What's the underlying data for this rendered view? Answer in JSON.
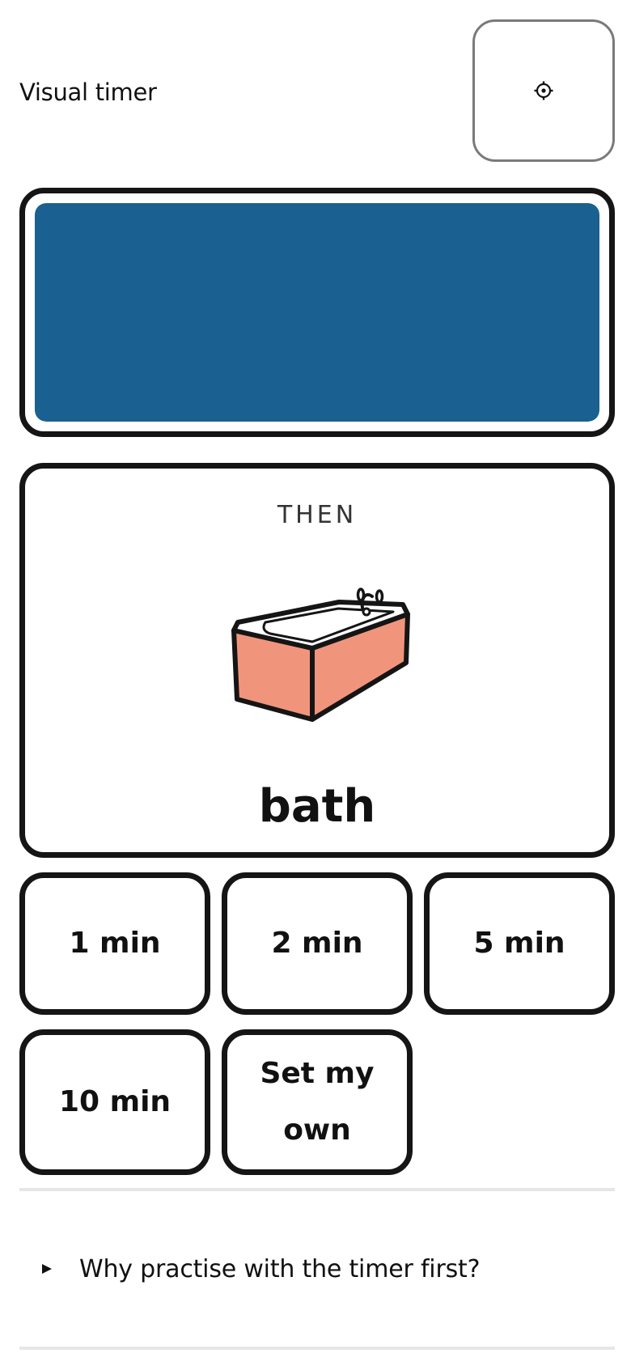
{
  "header": {
    "title": "Visual timer",
    "settings_glyph": "⚙",
    "settings_icon": "gear-icon"
  },
  "timer": {
    "remaining_fraction": 1.0,
    "fill_color": "#1a6090"
  },
  "then_card": {
    "label": "THEN",
    "activity": "bath",
    "image_icon": "bathtub-icon",
    "image_color": "#f0957c"
  },
  "durations": [
    {
      "label": "1 min"
    },
    {
      "label": "2 min"
    },
    {
      "label": "5 min"
    },
    {
      "label": "10 min"
    },
    {
      "label": "Set my own"
    }
  ],
  "disclosure": {
    "question": "Why practise with the timer first?",
    "arrow_icon": "triangle-right-icon"
  }
}
